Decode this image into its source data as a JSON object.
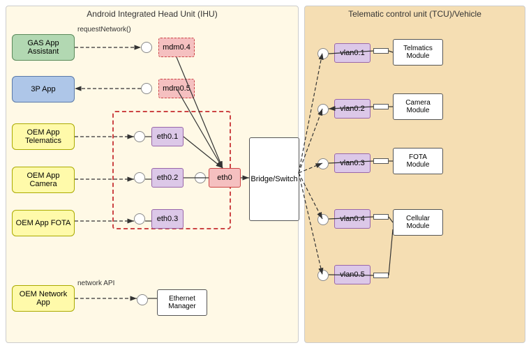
{
  "ihu": {
    "title": "Android Integrated Head Unit (IHU)",
    "apps": [
      {
        "id": "gas",
        "label": "GAS App Assistant"
      },
      {
        "id": "3p",
        "label": "3P App"
      },
      {
        "id": "oem-telematics",
        "label": "OEM App Telematics"
      },
      {
        "id": "oem-camera",
        "label": "OEM App Camera"
      },
      {
        "id": "oem-fota",
        "label": "OEM App FOTA"
      },
      {
        "id": "oem-network",
        "label": "OEM Network App"
      }
    ],
    "mdm": [
      {
        "id": "mdm04",
        "label": "mdm0.4"
      },
      {
        "id": "mdm05",
        "label": "mdm0.5"
      }
    ],
    "eth": [
      {
        "id": "eth01",
        "label": "eth0.1"
      },
      {
        "id": "eth02",
        "label": "eth0.2"
      },
      {
        "id": "eth03",
        "label": "eth0.3"
      },
      {
        "id": "eth0",
        "label": "eth0"
      }
    ],
    "labels": [
      {
        "id": "requestNetwork",
        "text": "requestNetwork()"
      },
      {
        "id": "networkAPI",
        "text": "network API"
      }
    ],
    "ethManager": {
      "label": "Ethernet\nManager"
    },
    "bridgeSwitch": {
      "label": "Bridge/Switch"
    }
  },
  "tcu": {
    "title": "Telematic control unit (TCU)/Vehicle",
    "vlans": [
      {
        "id": "vlan01",
        "label": "vlan0.1"
      },
      {
        "id": "vlan02",
        "label": "vlan0.2"
      },
      {
        "id": "vlan03",
        "label": "vlan0.3"
      },
      {
        "id": "vlan04",
        "label": "vlan0.4"
      },
      {
        "id": "vlan05",
        "label": "vlan0.5"
      }
    ],
    "modules": [
      {
        "id": "telmatics",
        "label": "Telmatics\nModule"
      },
      {
        "id": "camera",
        "label": "Camera\nModule"
      },
      {
        "id": "fota",
        "label": "FOTA\nModule"
      },
      {
        "id": "cellular",
        "label": "Cellular\nModule"
      }
    ]
  }
}
